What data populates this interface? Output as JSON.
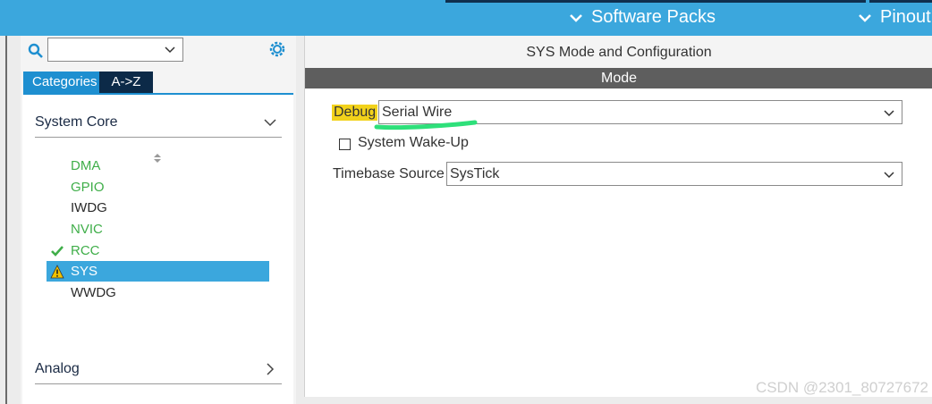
{
  "header": {
    "software_packs_label": "Software Packs",
    "pinout_label": "Pinout"
  },
  "left": {
    "tabs": [
      {
        "label": "Categories"
      },
      {
        "label": "A->Z"
      }
    ],
    "category": "System Core",
    "items": [
      {
        "label": "DMA",
        "status": "configured"
      },
      {
        "label": "GPIO",
        "status": "configured"
      },
      {
        "label": "IWDG",
        "status": "default"
      },
      {
        "label": "NVIC",
        "status": "configured"
      },
      {
        "label": "RCC",
        "status": "ok"
      },
      {
        "label": "SYS",
        "status": "warning"
      },
      {
        "label": "WWDG",
        "status": "default"
      }
    ],
    "footer_category": "Analog"
  },
  "right": {
    "title": "SYS Mode and Configuration",
    "mode_header": "Mode",
    "debug_label": "Debug",
    "debug_value": "Serial Wire",
    "wakeup_label": "System Wake-Up",
    "wakeup_checked": false,
    "timebase_label": "Timebase Source",
    "timebase_value": "SysTick"
  },
  "watermark": "CSDN @2301_80727672",
  "colors": {
    "header": "#3ba7dd",
    "selected": "#3ba7dd",
    "ok_green": "#3fae49",
    "warning": "#f2c200",
    "highlight": "#f2d21b",
    "annotation_stroke": "#2ee07a"
  }
}
